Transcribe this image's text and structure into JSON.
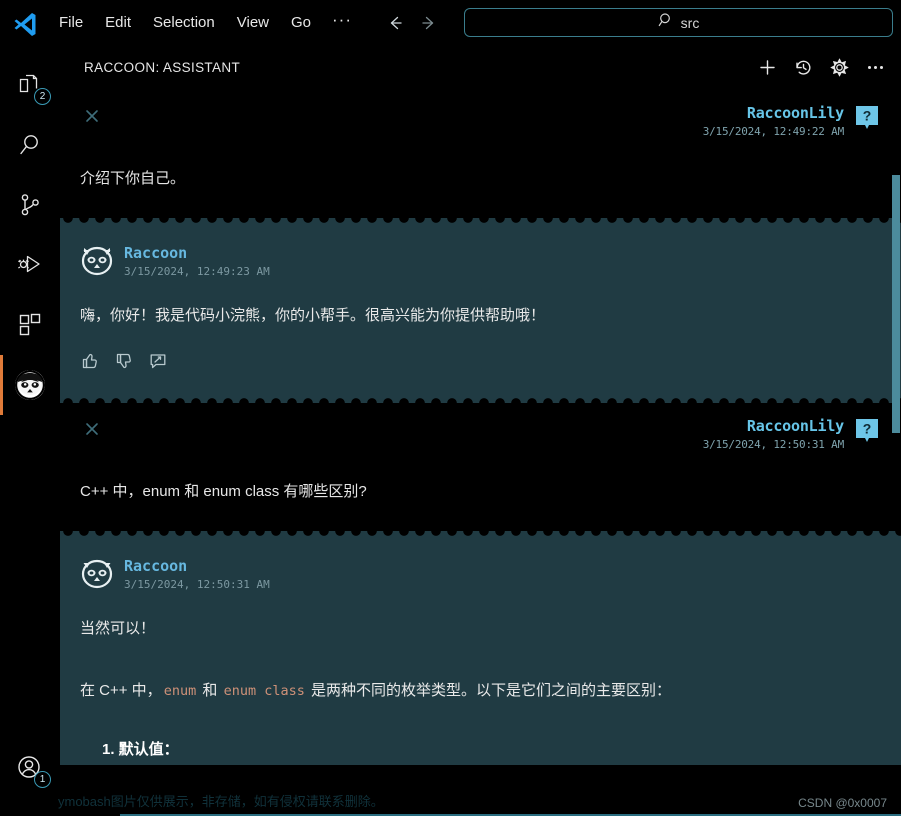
{
  "titlebar": {
    "logo_icon": "vscode-logo-icon",
    "menus": [
      {
        "label": "File"
      },
      {
        "label": "Edit"
      },
      {
        "label": "Selection"
      },
      {
        "label": "View"
      },
      {
        "label": "Go"
      }
    ],
    "overflow_label": "···",
    "back_icon": "arrow-left-icon",
    "forward_icon": "arrow-right-icon",
    "search": {
      "icon": "search-icon",
      "value": "src",
      "placeholder": "src"
    }
  },
  "activitybar": {
    "items": [
      {
        "name": "explorer",
        "icon": "files-icon",
        "badge": "2",
        "active": false
      },
      {
        "name": "search",
        "icon": "search-icon",
        "badge": "",
        "active": false
      },
      {
        "name": "source-control",
        "icon": "source-control-icon",
        "badge": "",
        "active": false
      },
      {
        "name": "run-and-debug",
        "icon": "run-debug-icon",
        "badge": "",
        "active": false
      },
      {
        "name": "extensions",
        "icon": "extensions-icon",
        "badge": "",
        "active": false
      },
      {
        "name": "raccoon",
        "icon": "raccoon-icon",
        "badge": "",
        "active": true
      }
    ],
    "account": {
      "name": "account",
      "icon": "account-icon",
      "badge": "1"
    }
  },
  "panel": {
    "title": "RACCOON: ASSISTANT",
    "actions": [
      {
        "name": "new-chat",
        "icon": "plus-icon"
      },
      {
        "name": "history",
        "icon": "history-icon"
      },
      {
        "name": "settings",
        "icon": "gear-icon"
      },
      {
        "name": "more-actions",
        "icon": "ellipsis-icon"
      }
    ]
  },
  "chat": {
    "messages": [
      {
        "role": "user",
        "name": "RaccoonLily",
        "timestamp": "3/15/2024, 12:49:22 AM",
        "text": "介绍下你自己。",
        "avatar_glyph": "?",
        "close_icon": "close-icon"
      },
      {
        "role": "assistant",
        "name": "Raccoon",
        "timestamp": "3/15/2024, 12:49:23 AM",
        "text": "嗨，你好！我是代码小浣熊，你的小帮手。很高兴能为你提供帮助哦！",
        "feedback": [
          {
            "name": "thumbs-up",
            "icon": "thumbs-up-icon"
          },
          {
            "name": "thumbs-down",
            "icon": "thumbs-down-icon"
          },
          {
            "name": "comment",
            "icon": "comment-edit-icon"
          }
        ]
      },
      {
        "role": "user",
        "name": "RaccoonLily",
        "timestamp": "3/15/2024, 12:50:31 AM",
        "text": "C++ 中，enum 和 enum class 有哪些区别?",
        "avatar_glyph": "?",
        "close_icon": "close-icon"
      },
      {
        "role": "assistant",
        "name": "Raccoon",
        "timestamp": "3/15/2024, 12:50:31 AM",
        "para1": "当然可以！",
        "para2_a": "在 C++ 中，",
        "para2_code1": "enum",
        "para2_b": "和",
        "para2_code2": "enum class",
        "para2_c": "是两种不同的枚举类型。以下是它们之间的主要区别：",
        "list_item1": "1. 默认值："
      }
    ]
  },
  "watermarks": {
    "left": "ymobash图片仅供展示，非存储，如有侵权请联系删除。",
    "right": "CSDN @0x0007"
  },
  "colors": {
    "accent_blue": "#67c5e8",
    "assistant_bg": "#203b43",
    "active_indicator": "#e07b39",
    "inline_code": "#ce9178",
    "scrollbar": "#4c8b9c"
  }
}
